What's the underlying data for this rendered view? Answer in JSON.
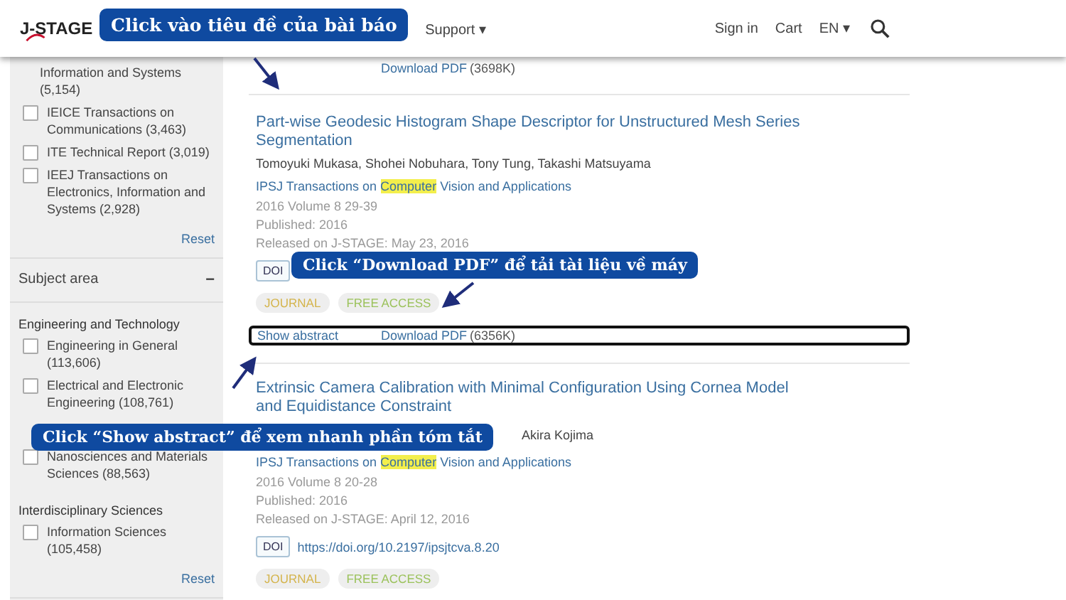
{
  "header": {
    "logo": "J-STAGE",
    "nav": [
      {
        "label": "Support",
        "caret": "▾"
      }
    ],
    "links": [
      "Sign in",
      "Cart"
    ],
    "language": {
      "label": "EN",
      "caret": "▾"
    }
  },
  "sidebar": {
    "groups": [
      {
        "kind": "filter",
        "items": [
          {
            "label": "Information and Systems (5,154)",
            "kind": "continuation"
          },
          {
            "label": "IEICE Transactions on Communications (3,463)",
            "kind": "checkbox",
            "checked": false
          },
          {
            "label": "ITE Technical Report (3,019)",
            "kind": "checkbox",
            "checked": false
          },
          {
            "label": "IEEJ Transactions on Electronics, Information and Systems (2,928)",
            "kind": "checkbox",
            "checked": false
          }
        ],
        "reset": "Reset"
      },
      {
        "kind": "section",
        "title": "Subject area",
        "toggle": "−",
        "expanded": true,
        "subgroups": [
          {
            "title": "Engineering and Technology",
            "items": [
              {
                "label": "Engineering in General (113,606)",
                "kind": "checkbox",
                "checked": false
              },
              {
                "label": "Electrical and Electronic Engineering (108,761)",
                "kind": "checkbox",
                "checked": false
              },
              {
                "label": "Nanosciences and Materials Sciences (88,563)",
                "kind": "checkbox",
                "checked": false
              }
            ]
          },
          {
            "title": "Interdisciplinary Sciences",
            "items": [
              {
                "label": "Information Sciences (105,458)",
                "kind": "checkbox",
                "checked": false
              }
            ]
          }
        ],
        "reset": "Reset"
      }
    ]
  },
  "articles": [
    {
      "links": [
        {
          "label": "Download PDF",
          "size": "(3698K)"
        }
      ]
    },
    {
      "title": "Part-wise Geodesic Histogram Shape Descriptor for Unstructured Mesh Series Segmentation",
      "authors": "Tomoyuki Mukasa, Shohei Nobuhara, Tony Tung, Takashi Matsuyama",
      "journal": {
        "before": "IPSJ Transactions on ",
        "highlight": "Computer",
        "after": " Vision and Applications"
      },
      "volume": "2016 Volume 8 29-39",
      "published": "Published: 2016",
      "released": "Released on J-STAGE: May 23, 2016",
      "doi": {
        "label": "DOI"
      },
      "tags": [
        {
          "label": "JOURNAL",
          "kind": "journal"
        },
        {
          "label": "FREE ACCESS",
          "kind": "access"
        }
      ],
      "outlined": true,
      "links": [
        {
          "label": "Show abstract"
        },
        {
          "label": "Download PDF",
          "size": "(6356K)"
        }
      ]
    },
    {
      "title": "Extrinsic Camera Calibration with Minimal Configuration Using Cornea Model and Equidistance Constraint",
      "authors": "Akira Kojima",
      "journal": {
        "before": "IPSJ Transactions on ",
        "highlight": "Computer",
        "after": " Vision and Applications"
      },
      "volume": "2016 Volume 8 20-28",
      "published": "Published: 2016",
      "released": "Released on J-STAGE: April 12, 2016",
      "doi": {
        "label": "DOI",
        "link": "https://doi.org/10.2197/ipsjtcva.8.20"
      },
      "tags": [
        {
          "label": "JOURNAL",
          "kind": "journal"
        },
        {
          "label": "FREE ACCESS",
          "kind": "access"
        }
      ]
    }
  ],
  "callouts": [
    {
      "text": "Click vào tiêu đề của bài báo"
    },
    {
      "text": "Click “Download PDF” để tải tài liệu về máy"
    },
    {
      "text": "Click “Show abstract” để xem nhanh phần tóm tắt"
    }
  ]
}
